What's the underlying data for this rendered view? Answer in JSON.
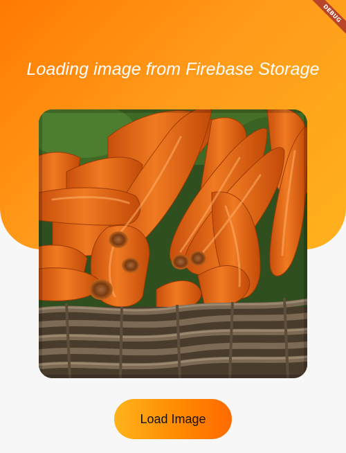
{
  "header": {
    "title": "Loading image from Firebase Storage"
  },
  "image": {
    "subject": "carrots-in-wicker-basket"
  },
  "actions": {
    "load_label": "Load Image"
  },
  "debug_banner": {
    "label": "DEBUG"
  },
  "colors": {
    "gradient_start": "#ff7a00",
    "gradient_end": "#ffb21c",
    "banner": "#b8442a",
    "background": "#f7f7f7"
  }
}
